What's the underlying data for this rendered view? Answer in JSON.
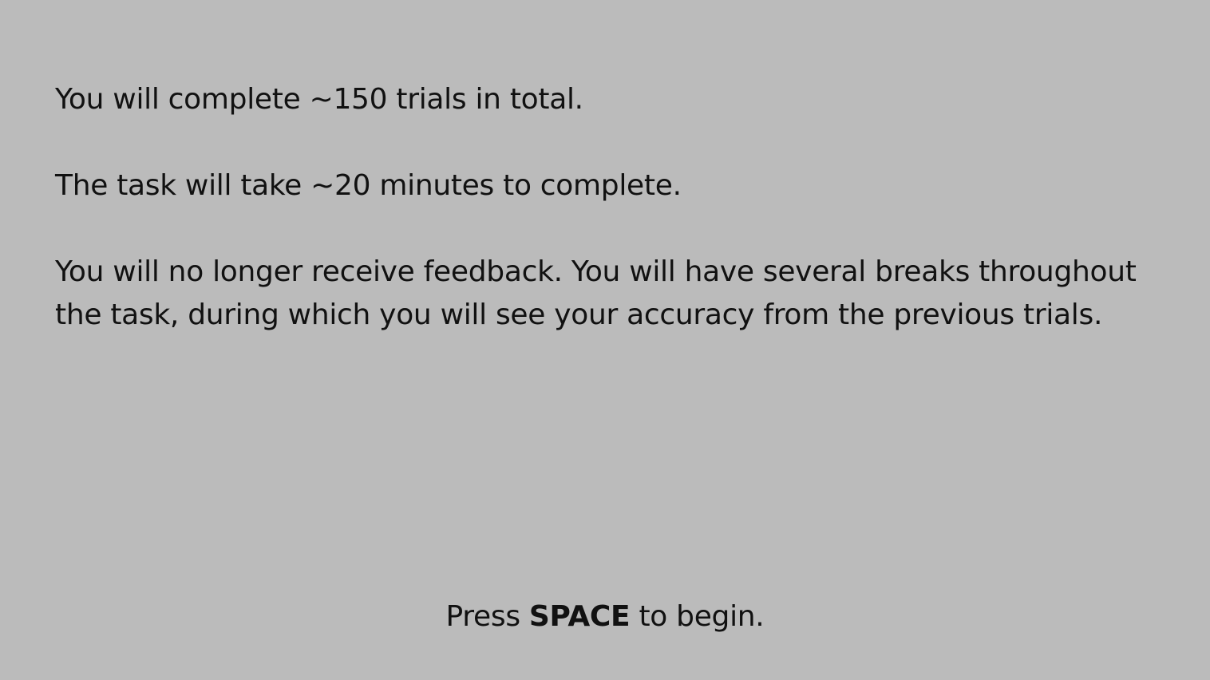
{
  "instructions": {
    "paragraphs": [
      "You will complete ~150 trials in total.",
      "The task will take ~20 minutes to complete.",
      "You will no longer receive feedback. You will have several breaks throughout the task, during which you will see your accuracy from the previous trials."
    ]
  },
  "prompt": {
    "before": "Press ",
    "key": "SPACE",
    "after": " to begin."
  },
  "colors": {
    "background": "#bbbbbb",
    "text": "#111111"
  }
}
